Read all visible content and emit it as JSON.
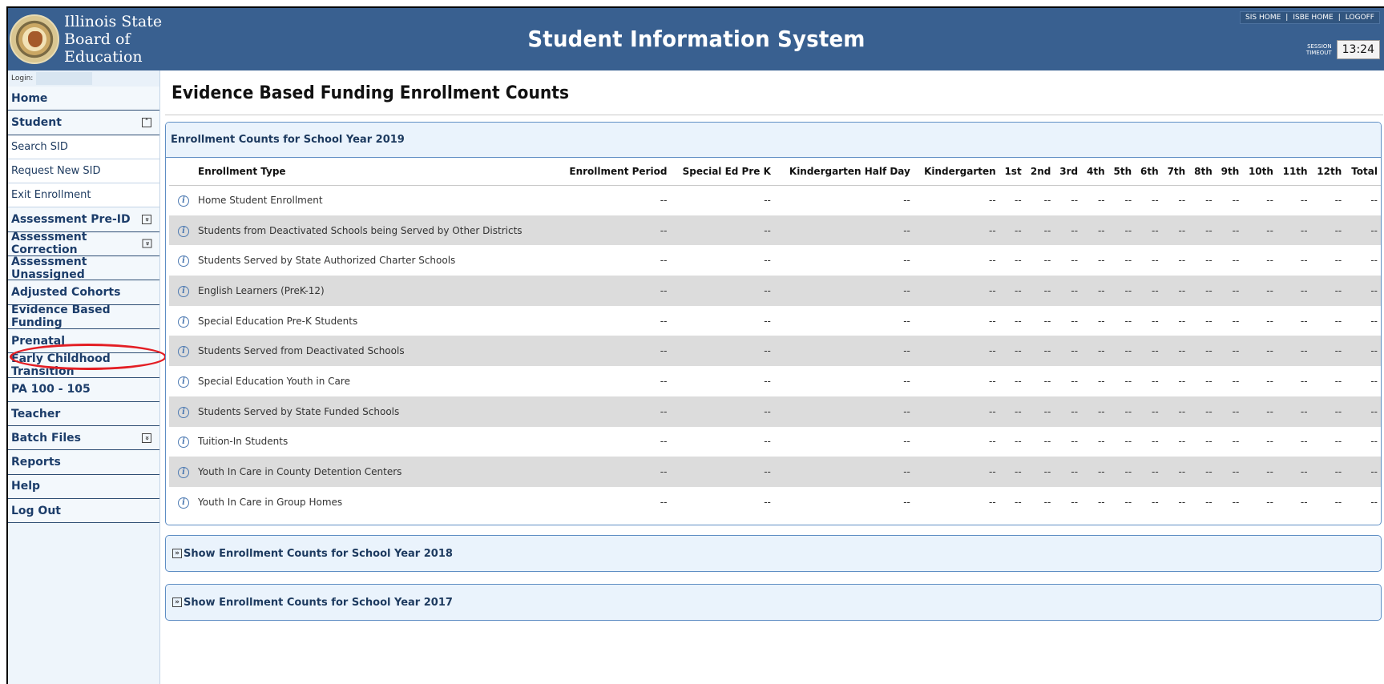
{
  "header": {
    "logo_line1": "Illinois State",
    "logo_line2": "Board of Education",
    "title": "Student Information System",
    "links": [
      "SIS HOME",
      "ISBE HOME",
      "LOGOFF"
    ],
    "session_label_1": "SESSION",
    "session_label_2": "TIMEOUT",
    "session_time": "13:24",
    "bg_color": "#396090"
  },
  "sidebar": {
    "login_label": "Login:",
    "items": [
      {
        "label": "Home",
        "type": "main"
      },
      {
        "label": "Student",
        "type": "main",
        "toggle": "collapse"
      },
      {
        "label": "Search SID",
        "type": "sub"
      },
      {
        "label": "Request New SID",
        "type": "sub"
      },
      {
        "label": "Exit Enrollment",
        "type": "sub"
      },
      {
        "label": "Assessment Pre-ID",
        "type": "main",
        "toggle": "expand"
      },
      {
        "label": "Assessment Correction",
        "type": "main",
        "toggle": "expand"
      },
      {
        "label": "Assessment Unassigned",
        "type": "main"
      },
      {
        "label": "Adjusted Cohorts",
        "type": "main"
      },
      {
        "label": "Evidence Based Funding",
        "type": "main",
        "highlighted": true
      },
      {
        "label": "Prenatal",
        "type": "main"
      },
      {
        "label": "Early Childhood Transition",
        "type": "main"
      },
      {
        "label": "PA 100 - 105",
        "type": "main"
      },
      {
        "label": "Teacher",
        "type": "main"
      },
      {
        "label": "Batch Files",
        "type": "main",
        "toggle": "expand"
      },
      {
        "label": "Reports",
        "type": "main"
      },
      {
        "label": "Help",
        "type": "main"
      },
      {
        "label": "Log Out",
        "type": "main"
      }
    ],
    "highlight_color": "#e31e24"
  },
  "main": {
    "page_title": "Evidence Based Funding Enrollment Counts",
    "panel_title": "Enrollment Counts for School Year  2019",
    "columns": [
      "Enrollment Type",
      "Enrollment Period",
      "Special Ed Pre K",
      "Kindergarten Half Day",
      "Kindergarten",
      "1st",
      "2nd",
      "3rd",
      "4th",
      "5th",
      "6th",
      "7th",
      "8th",
      "9th",
      "10th",
      "11th",
      "12th",
      "Total"
    ],
    "rows": [
      "Home Student Enrollment",
      "Students from Deactivated Schools being Served by Other Districts",
      "Students Served by State Authorized Charter Schools",
      "English Learners (PreK-12)",
      "Special Education Pre-K Students",
      "Students Served from Deactivated Schools",
      "Special Education Youth in Care",
      "Students Served by State Funded Schools",
      "Tuition-In Students",
      "Youth In Care in County Detention Centers",
      "Youth In Care in Group Homes"
    ],
    "empty_value": "--",
    "collapsed_panels": [
      "Show Enrollment Counts for School Year  2018",
      "Show Enrollment Counts for School Year  2017"
    ]
  }
}
